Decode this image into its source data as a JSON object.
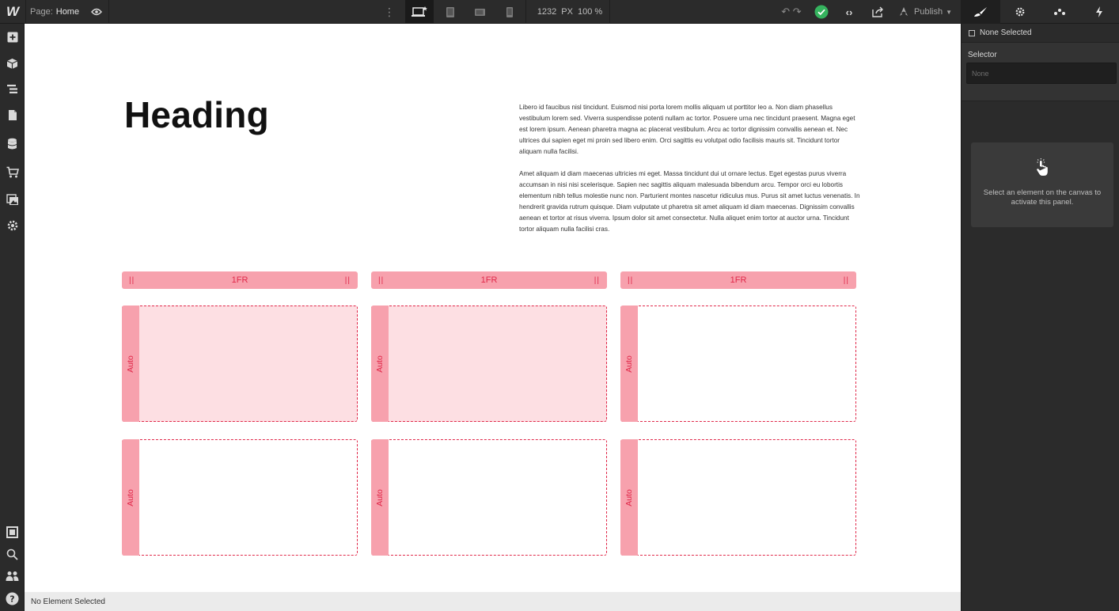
{
  "topbar": {
    "logo": "W",
    "page_label": "Page:",
    "page_name": "Home",
    "more": "⋮",
    "canvas_width": "1232",
    "canvas_unit": "PX",
    "zoom": "100 %",
    "publish_label": "Publish",
    "code": "‹›",
    "undo_redo": "↶ ↷"
  },
  "left_toolbar": [
    {
      "name": "add-elements-icon"
    },
    {
      "name": "symbols-icon"
    },
    {
      "name": "navigator-icon"
    },
    {
      "name": "pages-icon"
    },
    {
      "name": "cms-icon"
    },
    {
      "name": "ecommerce-icon"
    },
    {
      "name": "assets-icon"
    },
    {
      "name": "settings-icon"
    },
    {
      "name": "audit-icon"
    },
    {
      "name": "search-icon"
    },
    {
      "name": "collaborators-icon"
    },
    {
      "name": "help-icon"
    }
  ],
  "canvas": {
    "heading": "Heading",
    "paragraph1": "Libero id faucibus nisl tincidunt. Euismod nisi porta lorem mollis aliquam ut porttitor leo a. Non diam phasellus vestibulum lorem sed. Viverra suspendisse potenti nullam ac tortor. Posuere urna nec tincidunt praesent. Magna eget est lorem ipsum. Aenean pharetra magna ac placerat vestibulum. Arcu ac tortor dignissim convallis aenean et. Nec ultrices dui sapien eget mi proin sed libero enim. Orci sagittis eu volutpat odio facilisis mauris sit. Tincidunt tortor aliquam nulla facilisi.",
    "paragraph2": "Amet aliquam id diam maecenas ultricies mi eget. Massa tincidunt dui ut ornare lectus. Eget egestas purus viverra accumsan in nisi nisi scelerisque. Sapien nec sagittis aliquam malesuada bibendum arcu. Tempor orci eu lobortis elementum nibh tellus molestie nunc non. Parturient montes nascetur ridiculus mus. Purus sit amet luctus venenatis. In hendrerit gravida rutrum quisque. Diam vulputate ut pharetra sit amet aliquam id diam maecenas. Dignissim convallis aenean et tortor at risus viverra. Ipsum dolor sit amet consectetur. Nulla aliquet enim tortor at auctor urna. Tincidunt tortor aliquam nulla facilisi cras.",
    "grid": {
      "columns": [
        "1FR",
        "1FR",
        "1FR"
      ],
      "handle_glyph": "||",
      "row_label": "Auto",
      "rows": [
        [
          "filled",
          "filled",
          "empty"
        ],
        [
          "empty",
          "empty",
          "empty"
        ]
      ]
    }
  },
  "status_bar": {
    "text": "No Element Selected"
  },
  "right_panel": {
    "none_selected": "None Selected",
    "selector_label": "Selector",
    "selector_placeholder": "None",
    "hint": "Select an element on the canvas to activate this panel."
  },
  "colors": {
    "grid_handle": "#f7a1ad",
    "grid_text": "#e0294a",
    "cell_fill": "#fddfe3",
    "status_ok": "#35b35e"
  }
}
